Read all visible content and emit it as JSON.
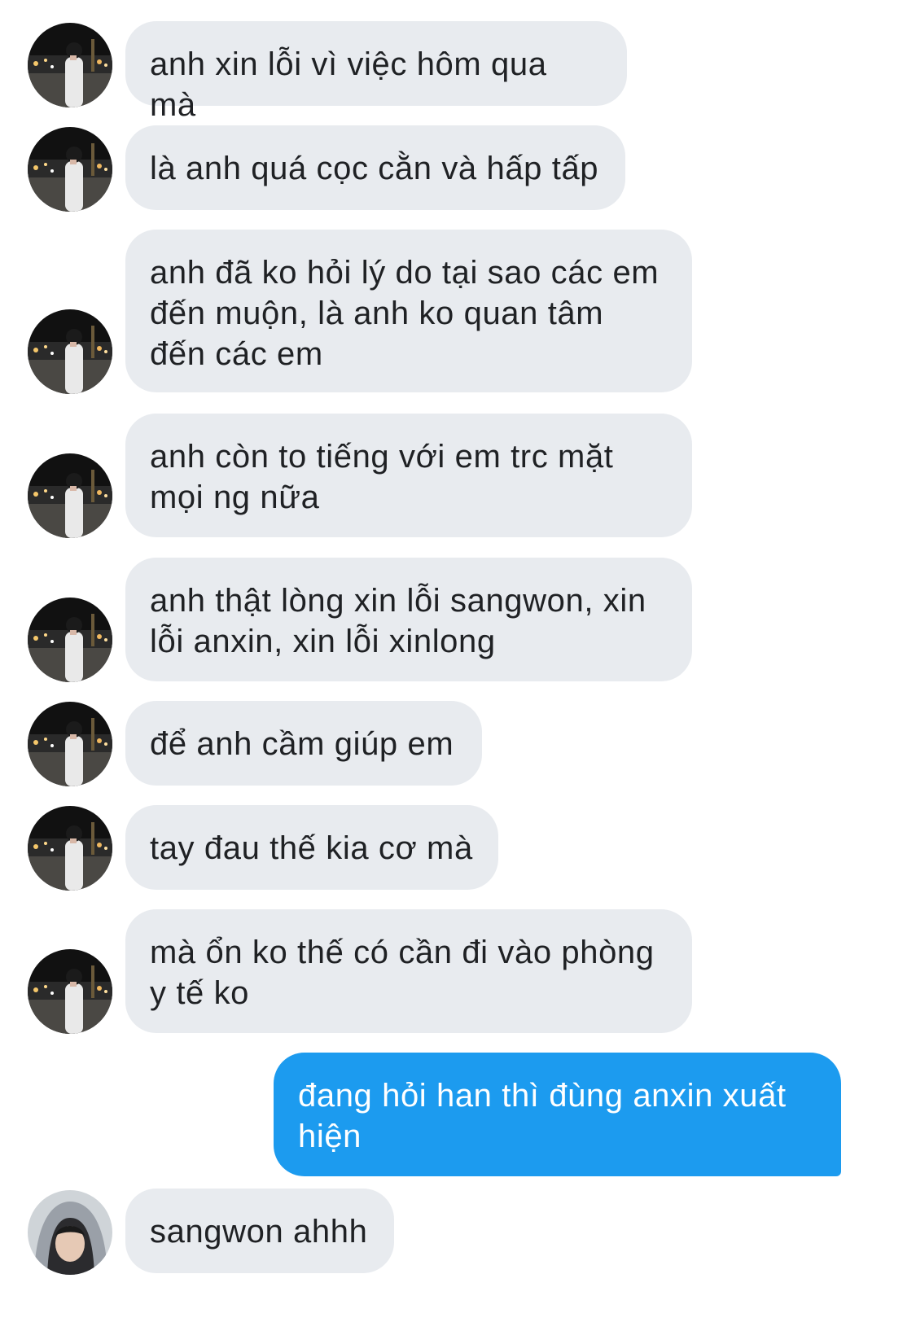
{
  "conversation": {
    "messages": [
      {
        "sender": "contact",
        "text": "anh xin lỗi vì việc hôm qua mà"
      },
      {
        "sender": "contact",
        "text": "là anh quá cọc cằn và hấp tấp"
      },
      {
        "sender": "contact",
        "text": "anh đã ko hỏi lý do tại sao các em đến muộn, là anh ko quan tâm đến các em"
      },
      {
        "sender": "contact",
        "text": "anh còn to tiếng với em trc mặt mọi ng nữa"
      },
      {
        "sender": "contact",
        "text": "anh thật lòng xin lỗi sangwon, xin lỗi anxin, xin lỗi xinlong"
      },
      {
        "sender": "contact",
        "text": "để anh cầm giúp em"
      },
      {
        "sender": "contact",
        "text": "tay đau thế kia cơ mà"
      },
      {
        "sender": "contact",
        "text": "mà ổn ko thế có cần đi vào phòng y tế ko"
      },
      {
        "sender": "me",
        "text": "đang hỏi han thì đùng anxin xuất hiện"
      },
      {
        "sender": "contact2",
        "text": "sangwon ahhh"
      }
    ]
  },
  "colors": {
    "incoming_bubble": "#e8ebef",
    "outgoing_bubble": "#1c9bef",
    "incoming_text": "#1f2124",
    "outgoing_text": "#ffffff"
  },
  "icons": {
    "avatar_contact": "avatar-photo-night-street",
    "avatar_contact2": "avatar-photo-hooded-person"
  }
}
